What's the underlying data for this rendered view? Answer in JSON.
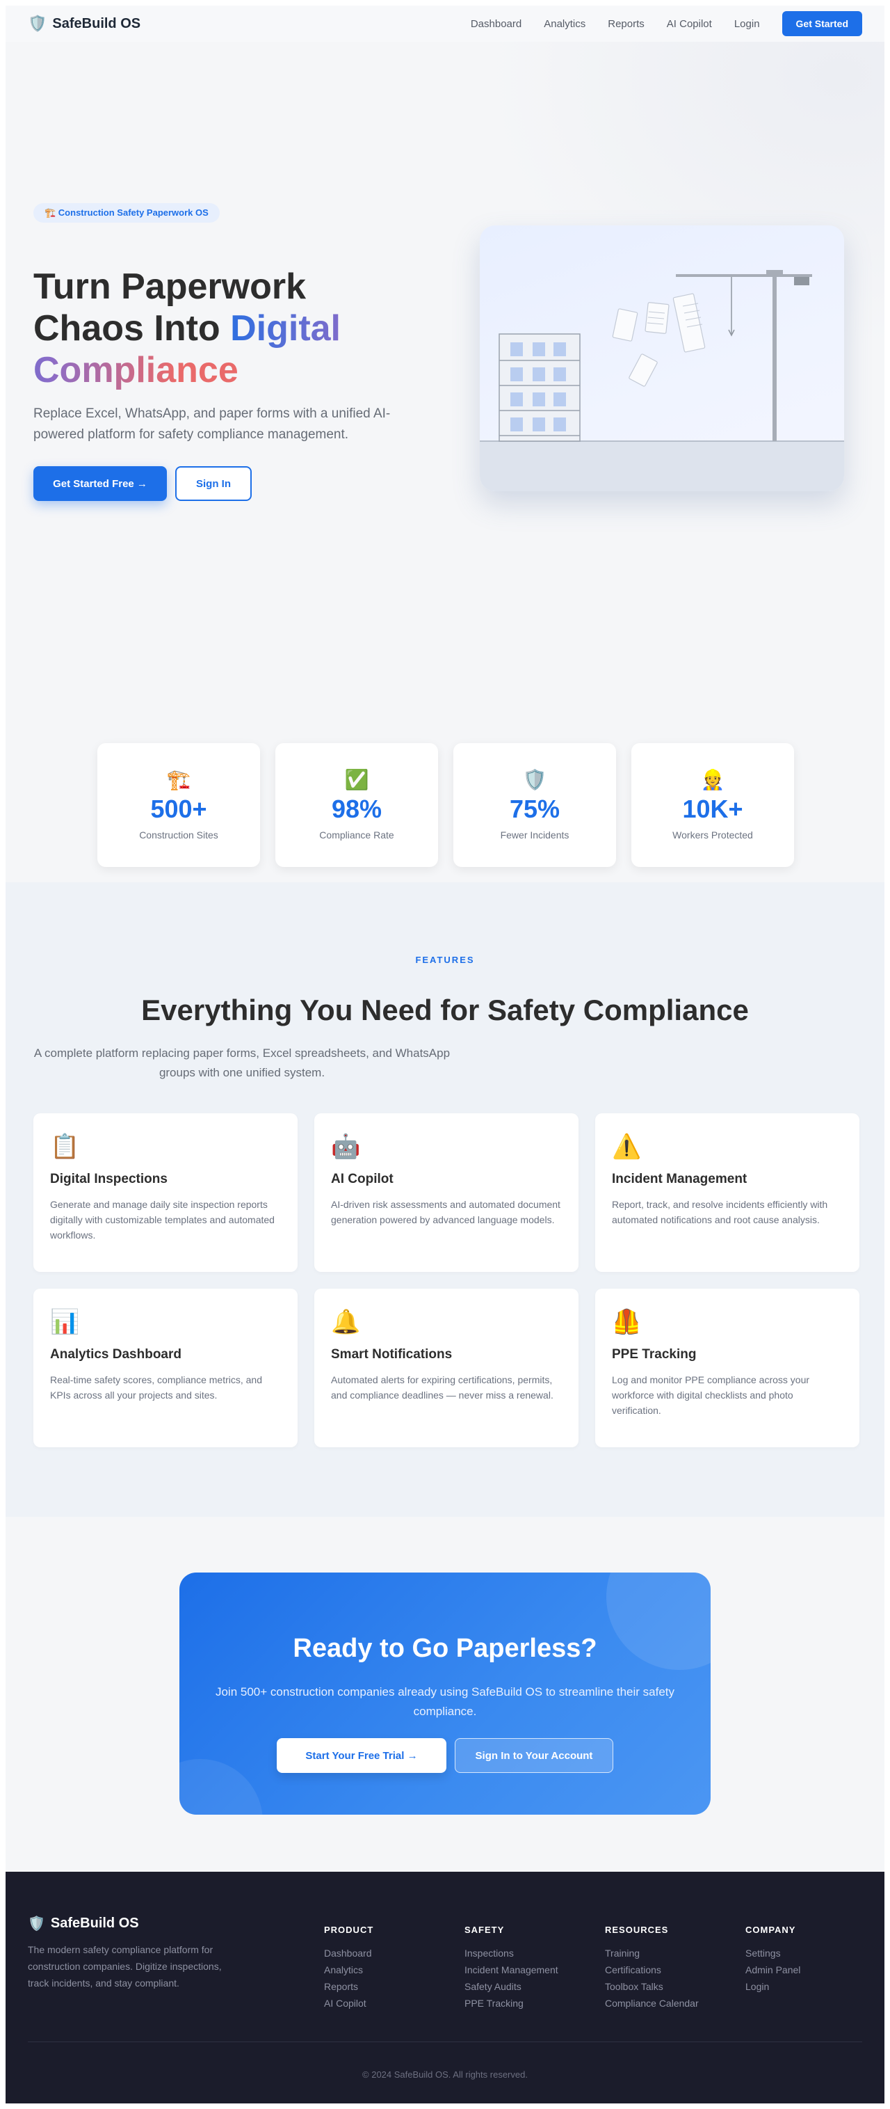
{
  "nav": {
    "logo_icon": "shield-icon",
    "brand": "SafeBuild OS",
    "links": [
      "Dashboard",
      "Analytics",
      "Reports",
      "AI Copilot",
      "Login"
    ],
    "cta": "Get Started"
  },
  "hero": {
    "badge": "🏗️ Construction Safety Paperwork OS",
    "title_plain": "Turn Paperwork Chaos Into ",
    "title_highlight": "Digital Compliance",
    "subtitle": "Replace Excel, WhatsApp, and paper forms with a unified AI-powered platform for safety compliance management.",
    "primary_button": "Get Started Free →",
    "secondary_button": "Sign In"
  },
  "stats": [
    {
      "icon": "🏗️",
      "value": "500+",
      "label": "Construction Sites"
    },
    {
      "icon": "✅",
      "value": "98%",
      "label": "Compliance Rate"
    },
    {
      "icon": "🛡️",
      "value": "75%",
      "label": "Fewer Incidents"
    },
    {
      "icon": "👷",
      "value": "10K+",
      "label": "Workers Protected"
    }
  ],
  "features": {
    "eyebrow": "FEATURES",
    "title": "Everything You Need for Safety Compliance",
    "subtitle": "A complete platform replacing paper forms, Excel spreadsheets, and WhatsApp groups with one unified system.",
    "cards": [
      {
        "icon": "📋",
        "title": "Digital Inspections",
        "desc": "Generate and manage daily site inspection reports digitally with customizable templates and automated workflows."
      },
      {
        "icon": "🤖",
        "title": "AI Copilot",
        "desc": "AI-driven risk assessments and automated document generation powered by advanced language models."
      },
      {
        "icon": "⚠️",
        "title": "Incident Management",
        "desc": "Report, track, and resolve incidents efficiently with automated notifications and root cause analysis."
      },
      {
        "icon": "📊",
        "title": "Analytics Dashboard",
        "desc": "Real-time safety scores, compliance metrics, and KPIs across all your projects and sites."
      },
      {
        "icon": "🔔",
        "title": "Smart Notifications",
        "desc": "Automated alerts for expiring certifications, permits, and compliance deadlines — never miss a renewal."
      },
      {
        "icon": "🦺",
        "title": "PPE Tracking",
        "desc": "Log and monitor PPE compliance across your workforce with digital checklists and photo verification."
      }
    ]
  },
  "cta": {
    "title": "Ready to Go Paperless?",
    "subtitle": "Join 500+ construction companies already using SafeBuild OS to streamline their safety compliance.",
    "primary_button": "Start Your Free Trial →",
    "secondary_button": "Sign In to Your Account"
  },
  "footer": {
    "brand": "SafeBuild OS",
    "description": "The modern safety compliance platform for construction companies. Digitize inspections, track incidents, and stay compliant.",
    "columns": [
      {
        "heading": "PRODUCT",
        "links": [
          "Dashboard",
          "Analytics",
          "Reports",
          "AI Copilot"
        ]
      },
      {
        "heading": "SAFETY",
        "links": [
          "Inspections",
          "Incident Management",
          "Safety Audits",
          "PPE Tracking"
        ]
      },
      {
        "heading": "RESOURCES",
        "links": [
          "Training",
          "Certifications",
          "Toolbox Talks",
          "Compliance Calendar"
        ]
      },
      {
        "heading": "COMPANY",
        "links": [
          "Settings",
          "Admin Panel",
          "Login"
        ]
      }
    ],
    "copyright": "© 2024 SafeBuild OS. All rights reserved."
  },
  "colors": {
    "primary": "#1d6fe8",
    "footer_bg": "#1b1c2b",
    "features_bg": "#eef2f7"
  }
}
